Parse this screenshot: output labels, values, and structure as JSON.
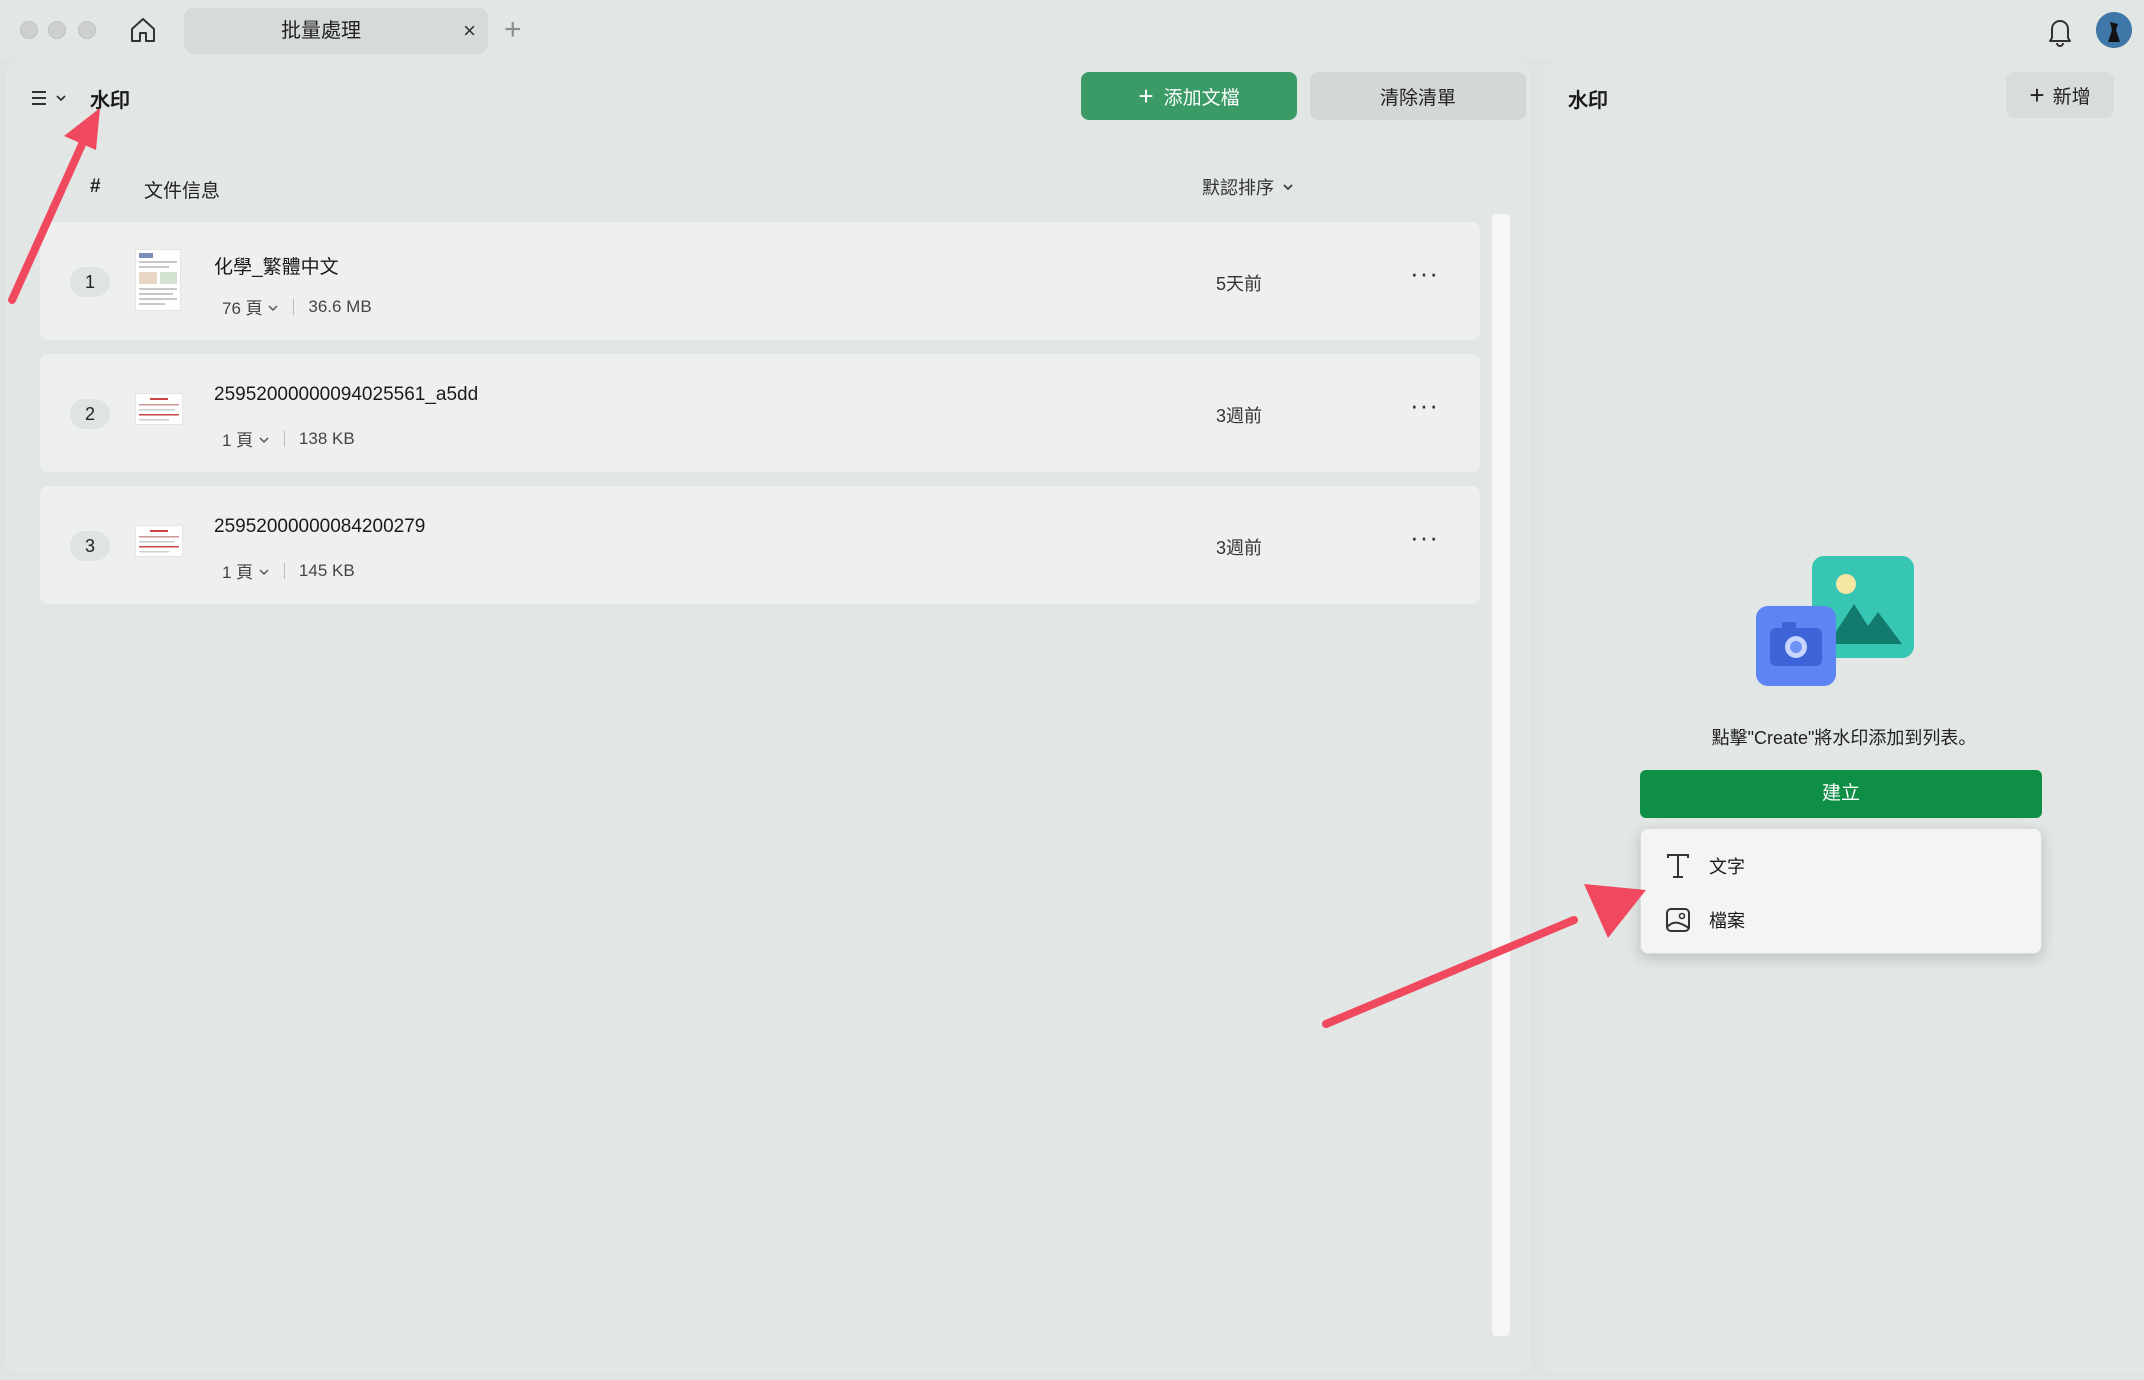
{
  "tab": {
    "title": "批量處理",
    "close": "×",
    "new": "+"
  },
  "left": {
    "title": "水印",
    "add_button": "添加文檔",
    "add_plus": "+",
    "clear_button": "清除清單",
    "col_hash": "#",
    "col_info": "文件信息",
    "sort_label": "默認排序",
    "files": [
      {
        "num": "1",
        "name": "化學_繁體中文",
        "pages": "76 頁",
        "size": "36.6 MB",
        "time": "5天前",
        "more": "···"
      },
      {
        "num": "2",
        "name": "25952000000094025561_a5dd",
        "pages": "1 頁",
        "size": "138 KB",
        "time": "3週前",
        "more": "···"
      },
      {
        "num": "3",
        "name": "25952000000084200279",
        "pages": "1 頁",
        "size": "145 KB",
        "time": "3週前",
        "more": "···"
      }
    ]
  },
  "right": {
    "title": "水印",
    "new_button": "新增",
    "new_plus": "+",
    "hint": "點擊\"Create\"將水印添加到列表。",
    "create_button": "建立",
    "menu": [
      {
        "label": "文字",
        "icon": "text-icon"
      },
      {
        "label": "檔案",
        "icon": "image-file-icon"
      }
    ]
  },
  "colors": {
    "accent": "#3a9b66",
    "create": "#0f8f45",
    "annotation": "#f0495f"
  }
}
